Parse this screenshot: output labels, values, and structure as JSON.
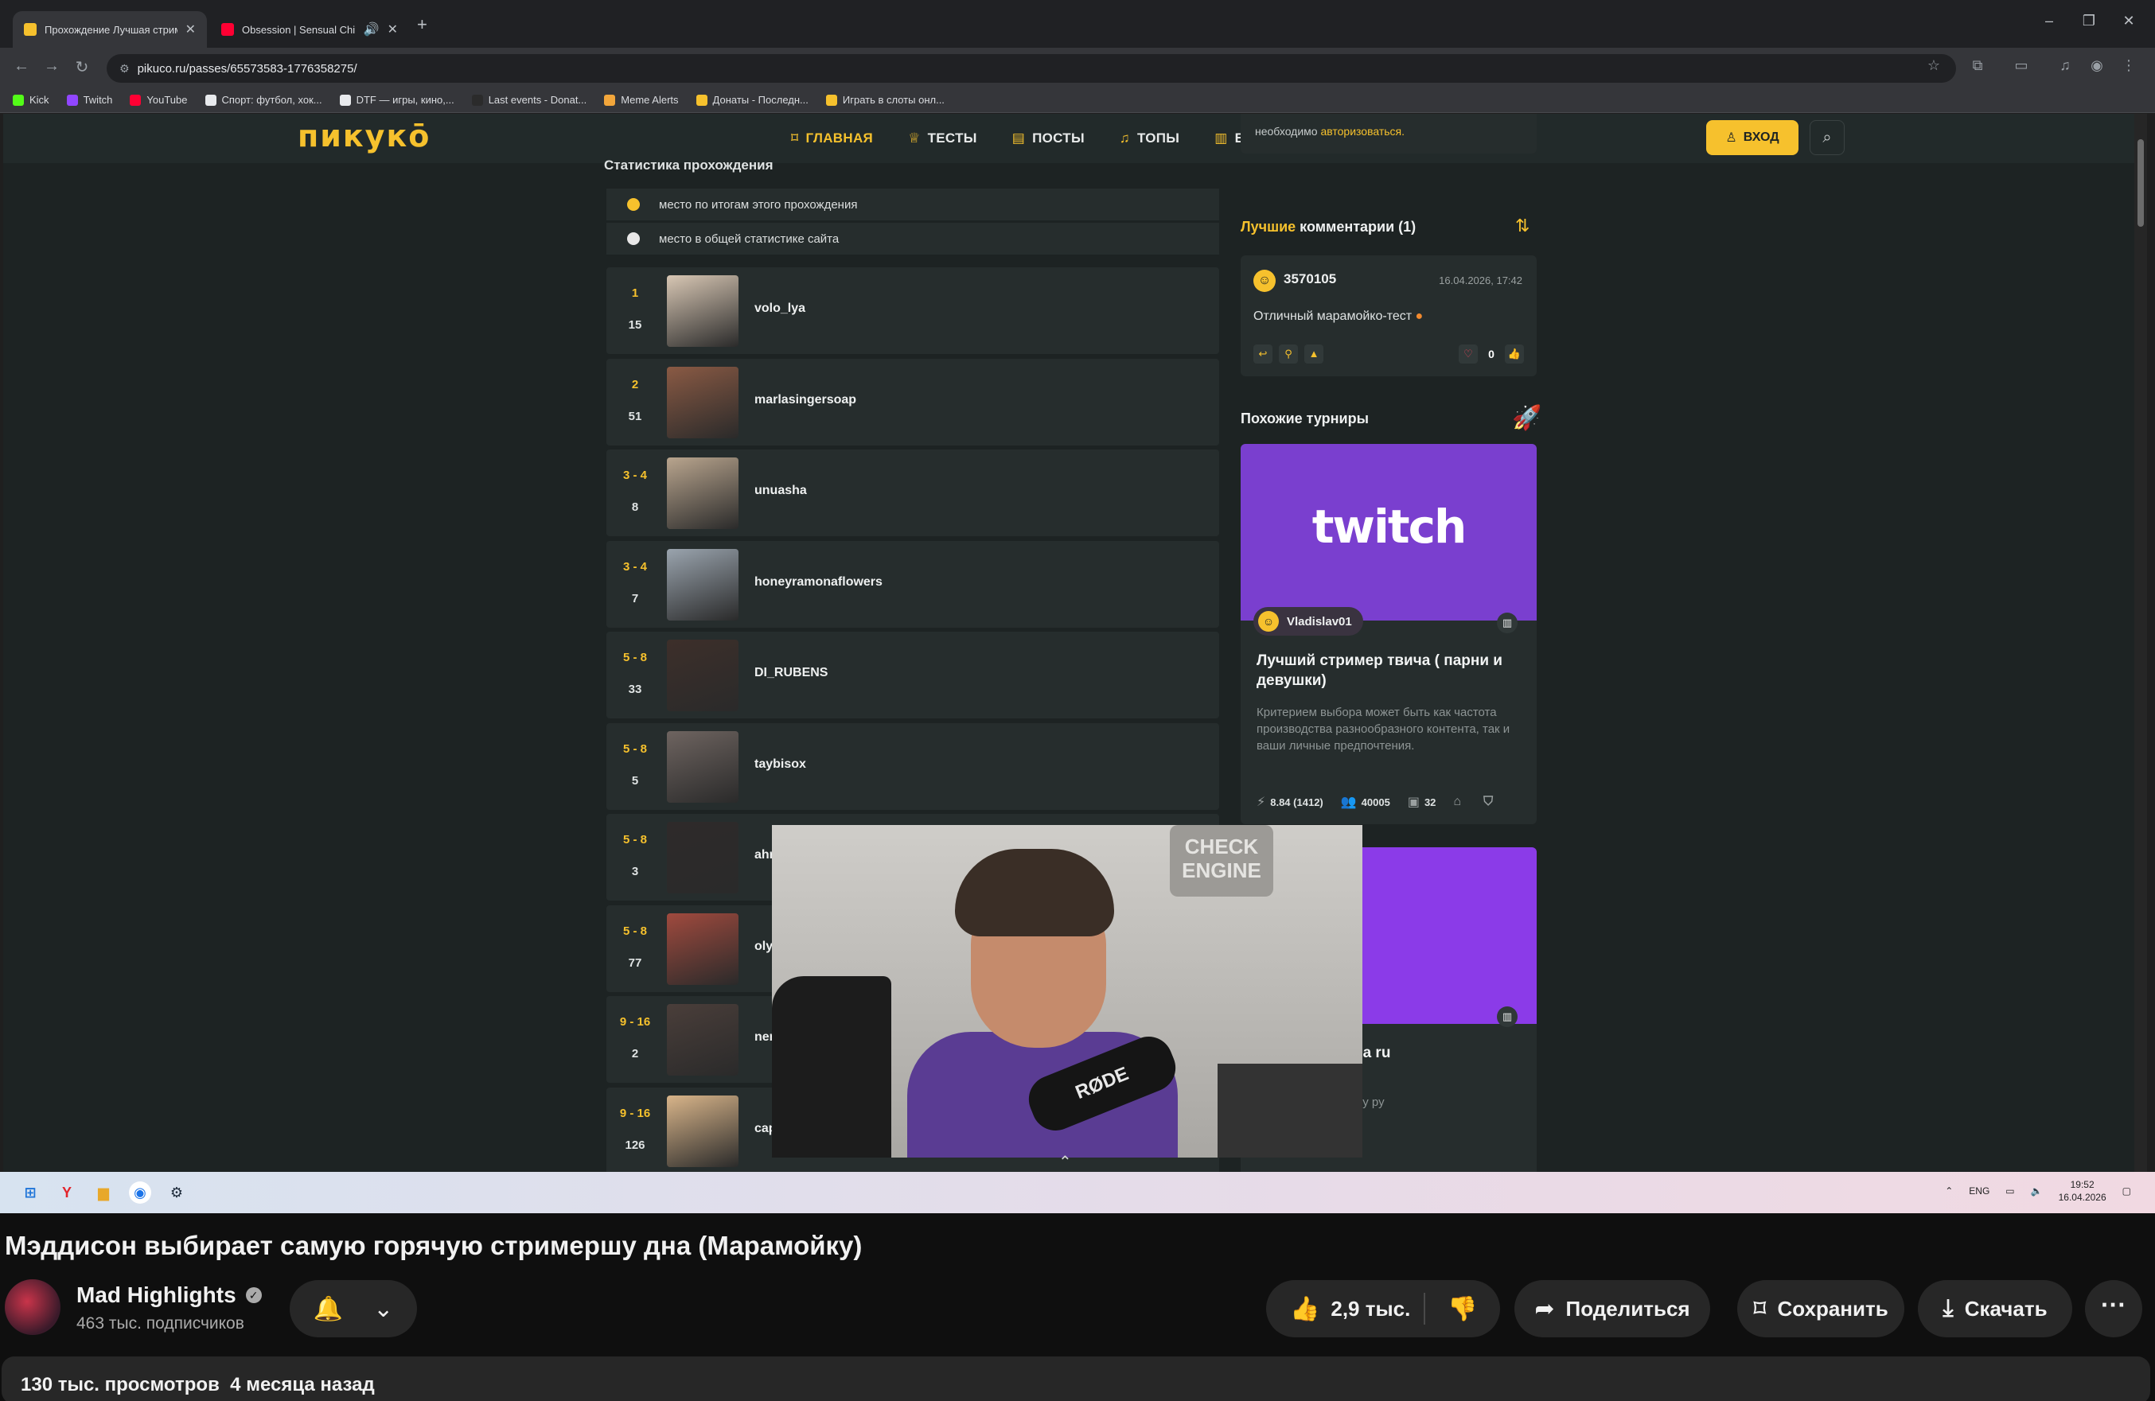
{
  "browser": {
    "tabs": [
      {
        "label": "Прохождение Лучшая стрим...",
        "favicon_color": "#f6c12d",
        "active": true
      },
      {
        "label": "Obsession | Sensual Chill S...",
        "favicon_color": "#ff0033",
        "active": false
      }
    ],
    "url": "pikuco.ru/passes/65573583-1776358275/",
    "bookmarks": [
      {
        "label": "Kick",
        "color": "#53fc18"
      },
      {
        "label": "Twitch",
        "color": "#9146ff"
      },
      {
        "label": "YouTube",
        "color": "#ff0033"
      },
      {
        "label": "Спорт: футбол, хок...",
        "color": "#e8eaed"
      },
      {
        "label": "DTF — игры, кино,...",
        "color": "#e8eaed"
      },
      {
        "label": "Last events - Donat...",
        "color": "#2b2b2b"
      },
      {
        "label": "Meme Alerts",
        "color": "#f2a63b"
      },
      {
        "label": "Донаты - Последн...",
        "color": "#f6c12d"
      },
      {
        "label": "Играть в слоты онл...",
        "color": "#f6c12d"
      }
    ]
  },
  "site": {
    "logo": "пикукō",
    "nav": [
      {
        "label": "ГЛАВНАЯ",
        "icon": "bookmark-icon",
        "current": true
      },
      {
        "label": "ТЕСТЫ",
        "icon": "trophy-icon",
        "current": false
      },
      {
        "label": "ПОСТЫ",
        "icon": "document-icon",
        "current": false
      },
      {
        "label": "ТОПЫ",
        "icon": "bell-icon",
        "current": false
      },
      {
        "label": "БИБЛИОТЕКА",
        "icon": "book-icon",
        "current": false
      },
      {
        "label": "СОЗДАТЬ",
        "icon": "bulb-icon",
        "current": false
      }
    ],
    "login_label": "ВХОД",
    "stats": {
      "title": "Статистика прохождения",
      "legend": [
        {
          "label": "место по итогам этого прохождения",
          "color": "#f6c12d"
        },
        {
          "label": "место в общей статистике сайта",
          "color": "#e8e8e8"
        }
      ],
      "rows": [
        {
          "rank": "1",
          "site_rank": "15",
          "name": "volo_lya",
          "av": "#d8c7b4"
        },
        {
          "rank": "2",
          "site_rank": "51",
          "name": "marlasingersoap",
          "av": "#8a5a44"
        },
        {
          "rank": "3 - 4",
          "site_rank": "8",
          "name": "unuasha",
          "av": "#b9a58e"
        },
        {
          "rank": "3 - 4",
          "site_rank": "7",
          "name": "honeyramonaflowers",
          "av": "#9aa4ae"
        },
        {
          "rank": "5 - 8",
          "site_rank": "33",
          "name": "DI_RUBENS",
          "av": "#3d2f2a"
        },
        {
          "rank": "5 - 8",
          "site_rank": "5",
          "name": "taybisox",
          "av": "#6e6460"
        },
        {
          "rank": "5 - 8",
          "site_rank": "3",
          "name": "ahr",
          "av": "#2e2a2a"
        },
        {
          "rank": "5 - 8",
          "site_rank": "77",
          "name": "oly",
          "av": "#a04a3e"
        },
        {
          "rank": "9 - 16",
          "site_rank": "2",
          "name": "ner",
          "av": "#4a3e3a"
        },
        {
          "rank": "9 - 16",
          "site_rank": "126",
          "name": "cap",
          "av": "#d9b58a"
        }
      ]
    },
    "side": {
      "top_card_text_a": "необходимо ",
      "top_card_text_b": "авторизоваться.",
      "best_prefix": "Лучшие",
      "best_suffix": " комментарии (1)",
      "comment": {
        "user": "3570105",
        "date": "16.04.2026, 17:42",
        "text": "Отличный марамойко-тест",
        "votes": "0"
      },
      "similar_title": "Похожие турниры",
      "tournament1": {
        "banner_text": "twitch",
        "author": "Vladislav01",
        "title": "Лучший стример твича ( парни и девушки)",
        "desc": "Критерием выбора может быть как частота производства разнообразного контента, так и ваши личные предпочтения.",
        "rating": "8.84",
        "votes": "(1412)",
        "players": "40005",
        "items": "32"
      },
      "tournament2": {
        "title_partial": "вая стримерша ru",
        "desc_partial": "расивую стримершу ру"
      }
    },
    "webcam_sign": "CHECK ENGINE",
    "mic_label": "RØDE"
  },
  "taskbar": {
    "lang": "ENG",
    "time": "19:52",
    "date": "16.04.2026"
  },
  "youtube": {
    "title": "Мэддисон выбирает самую горячую стримершу дна (Марамойку)",
    "channel": "Mad Highlights",
    "subscribers": "463 тыс. подписчиков",
    "likes": "2,9 тыс.",
    "share": "Поделиться",
    "save": "Сохранить",
    "download": "Скачать",
    "views": "130 тыс. просмотров",
    "ago": "4 месяца назад"
  }
}
